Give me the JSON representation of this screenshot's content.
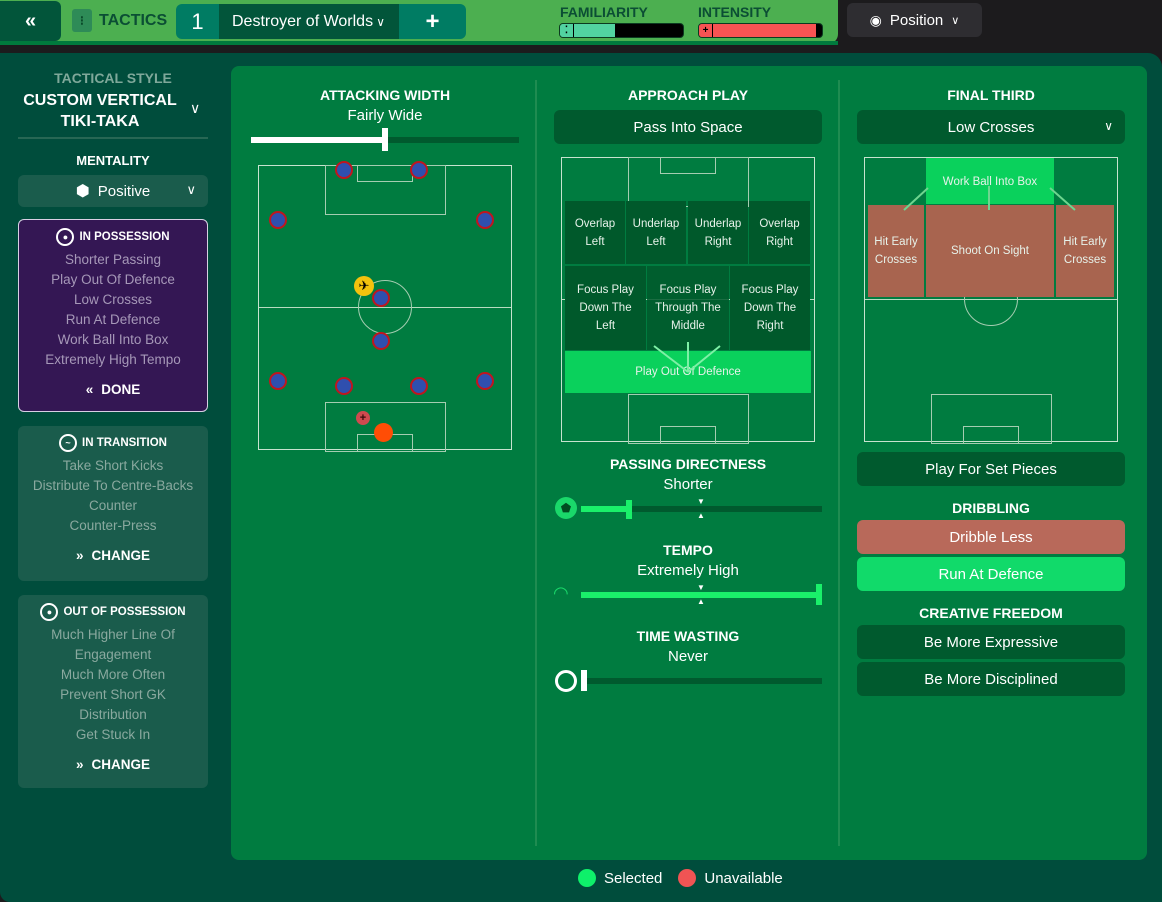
{
  "topbar": {
    "back_icon": "double-chevron-left-icon",
    "back_glyph": "«",
    "section_label": "TACTICS",
    "tactic_slot": "1",
    "tactic_name": "Destroyer of Worlds",
    "add_glyph": "+",
    "familiarity_label": "FAMILIARITY",
    "familiarity_value": 0.45,
    "intensity_label": "INTENSITY",
    "intensity_value": 0.95,
    "view_button": "Position"
  },
  "sidebar": {
    "tactical_style_label": "TACTICAL STYLE",
    "tactical_style_name": "CUSTOM VERTICAL TIKI-TAKA",
    "mentality_label": "MENTALITY",
    "mentality_value": "Positive",
    "in_possession": {
      "title": "IN POSSESSION",
      "items": [
        "Shorter Passing",
        "Play Out Of Defence",
        "Low Crosses",
        "Run At Defence",
        "Work Ball Into Box",
        "Extremely High Tempo"
      ],
      "button": "DONE"
    },
    "in_transition": {
      "title": "IN TRANSITION",
      "items": [
        "Take Short Kicks",
        "Distribute To Centre-Backs",
        "Counter",
        "Counter-Press"
      ],
      "button": "CHANGE"
    },
    "out_of_possession": {
      "title": "OUT OF POSSESSION",
      "items": [
        "Much Higher Line Of",
        "Engagement",
        "Much More Often",
        "Prevent Short GK",
        "Distribution",
        "Get Stuck In"
      ],
      "button": "CHANGE"
    }
  },
  "attacking_width": {
    "title": "ATTACKING WIDTH",
    "value": "Fairly Wide",
    "level": 0.5
  },
  "approach_play": {
    "title": "APPROACH PLAY",
    "selected": "Pass Into Space",
    "zones": {
      "overlap_left": "Overlap Left",
      "underlap_left": "Underlap Left",
      "underlap_right": "Underlap Right",
      "overlap_right": "Overlap Right",
      "focus_left": "Focus Play Down The Left",
      "focus_middle": "Focus Play Through The Middle",
      "focus_right": "Focus Play Down The Right",
      "play_out": "Play Out Of Defence"
    }
  },
  "passing_directness": {
    "title": "PASSING DIRECTNESS",
    "value": "Shorter",
    "level": 0.2
  },
  "tempo": {
    "title": "TEMPO",
    "value": "Extremely High",
    "level": 1.0
  },
  "time_wasting": {
    "title": "TIME WASTING",
    "value": "Never",
    "level": 0.0
  },
  "final_third": {
    "title": "FINAL THIRD",
    "selected": "Low Crosses",
    "zones": {
      "work_ball": "Work Ball Into Box",
      "early_cross_left": "Hit Early Crosses",
      "shoot": "Shoot On Sight",
      "early_cross_right": "Hit Early Crosses"
    },
    "set_pieces": "Play For Set Pieces"
  },
  "dribbling": {
    "title": "DRIBBLING",
    "options": [
      "Dribble Less",
      "Run At Defence"
    ]
  },
  "creative_freedom": {
    "title": "CREATIVE FREEDOM",
    "options": [
      "Be More Expressive",
      "Be More Disciplined"
    ]
  },
  "legend": {
    "selected": "Selected",
    "unavailable": "Unavailable"
  },
  "colors": {
    "selected": "#0ef06a",
    "unavailable": "#f05454",
    "pitch": "#007c40",
    "possession_card": "#341754"
  }
}
